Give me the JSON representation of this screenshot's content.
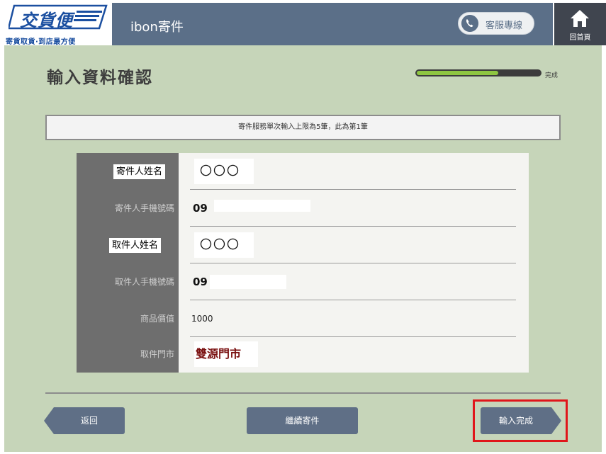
{
  "brand": {
    "logo_title": "交貨便",
    "logo_subtitle": "寄貨取貨·到店最方便"
  },
  "topbar": {
    "title": "ibon寄件",
    "customer_service_label": "客服專線",
    "home_label": "回首頁"
  },
  "page": {
    "title": "輸入資料確認",
    "progress_label": "完成",
    "progress_fraction": 0.66,
    "notice": "寄件服務單次輸入上限為5筆，此為第1筆"
  },
  "form": {
    "rows": [
      {
        "label": "寄件人姓名",
        "value": "〇〇〇"
      },
      {
        "label": "寄件人手機號碼",
        "value": "09"
      },
      {
        "label": "取件人姓名",
        "value": "〇〇〇"
      },
      {
        "label": "取件人手機號碼",
        "value": "09"
      },
      {
        "label": "商品價值",
        "value": "1000"
      },
      {
        "label": "取件門市",
        "value": "雙源門市"
      }
    ]
  },
  "buttons": {
    "back": "返回",
    "continue": "繼續寄件",
    "finish": "輸入完成"
  },
  "colors": {
    "topbar": "#5b6f88",
    "main_bg": "#c6d5b9",
    "button": "#5f6f86",
    "highlight": "#e0161a",
    "progress_fill": "#8ec641"
  }
}
